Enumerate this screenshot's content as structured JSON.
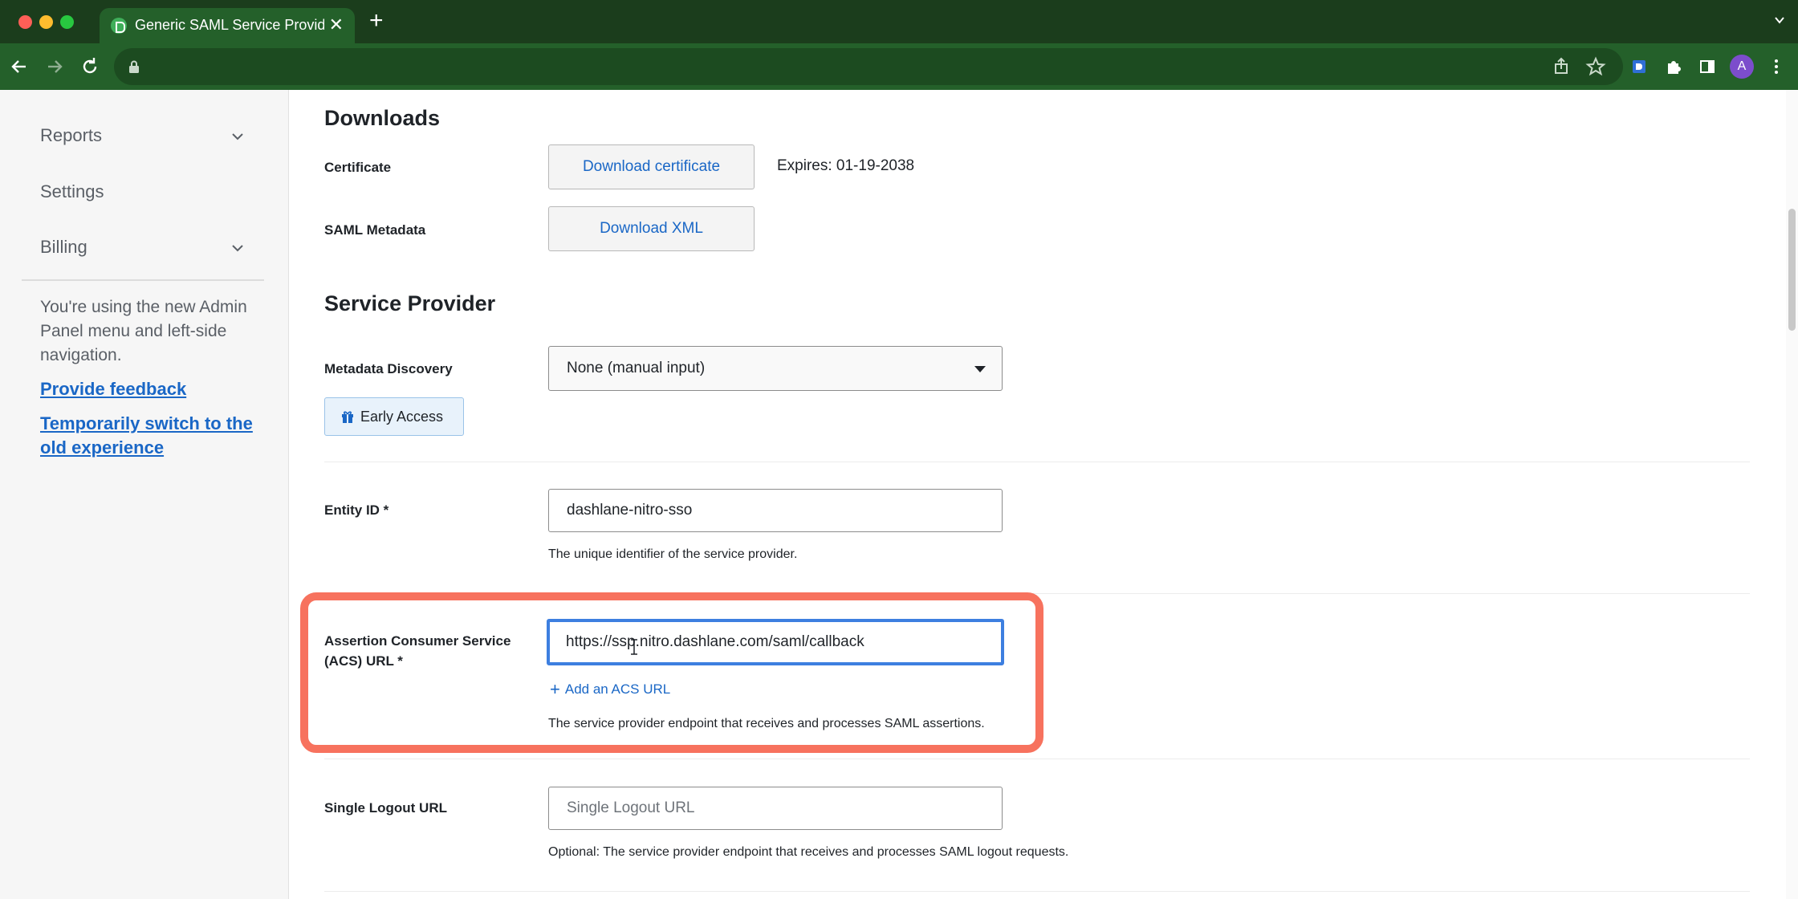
{
  "browser": {
    "tab_title": "Generic SAML Service Provider",
    "tab_close": "✕",
    "new_tab": "+",
    "avatar_letter": "A"
  },
  "sidebar": {
    "items": [
      {
        "label": "Reports",
        "has_chevron": true
      },
      {
        "label": "Settings",
        "has_chevron": false
      },
      {
        "label": "Billing",
        "has_chevron": true
      }
    ],
    "note": "You're using the new Admin Panel menu and left-side navigation.",
    "feedback_link": "Provide feedback",
    "switch_link": "Temporarily switch to the old experience"
  },
  "downloads": {
    "title": "Downloads",
    "certificate_label": "Certificate",
    "certificate_button": "Download certificate",
    "expires": "Expires: 01-19-2038",
    "metadata_label": "SAML Metadata",
    "metadata_button": "Download XML"
  },
  "service_provider": {
    "title": "Service Provider",
    "metadata_discovery_label": "Metadata Discovery",
    "metadata_discovery_value": "None (manual input)",
    "early_access_badge": "Early Access",
    "entity_id_label": "Entity ID *",
    "entity_id_value": "dashlane-nitro-sso",
    "entity_id_help": "The unique identifier of the service provider.",
    "acs_label": "Assertion Consumer Service (ACS) URL *",
    "acs_value": "https://ssp.nitro.dashlane.com/saml/callback",
    "add_acs_label": "Add an ACS URL",
    "acs_help": "The service provider endpoint that receives and processes SAML assertions.",
    "slo_label": "Single Logout URL",
    "slo_placeholder": "Single Logout URL",
    "slo_value": "",
    "slo_help": "Optional: The service provider endpoint that receives and processes SAML logout requests."
  },
  "colors": {
    "browser_frame": "#1b3d1c",
    "toolbar": "#24602a",
    "link": "#1a67c6",
    "focus_ring": "#3d7fe0",
    "highlight": "#f7725e"
  }
}
